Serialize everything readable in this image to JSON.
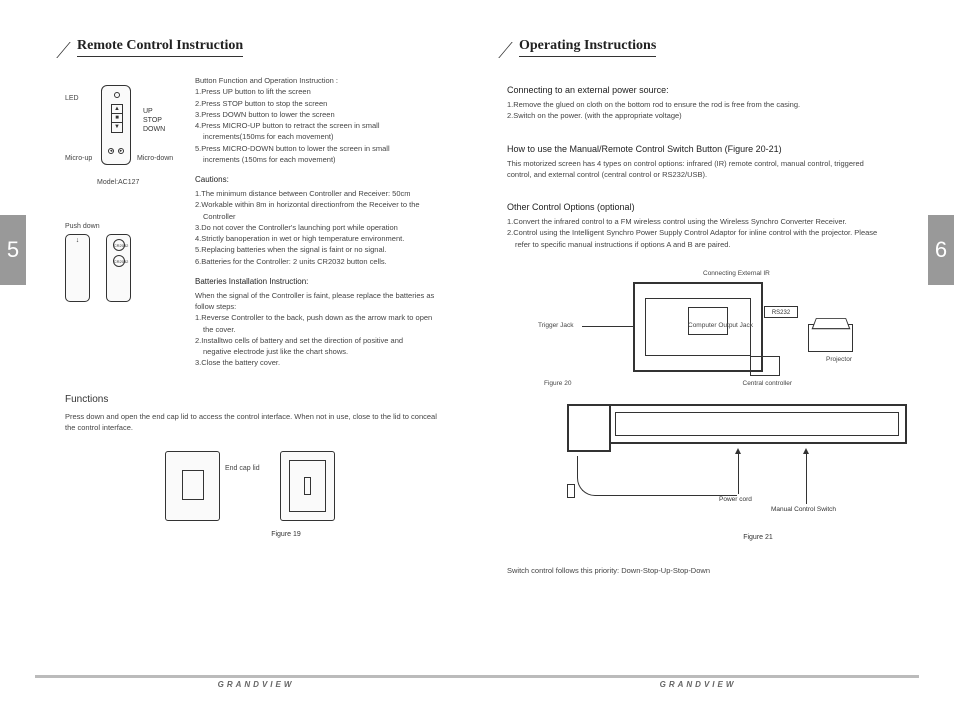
{
  "page_numbers": {
    "left": "5",
    "right": "6"
  },
  "brand": "GRANDVIEW",
  "left": {
    "title": "Remote Control Instruction",
    "diagram_labels": {
      "led": "LED",
      "up": "UP",
      "stop": "STOP",
      "down": "DOWN",
      "micro_up": "Micro-up",
      "micro_down": "Micro-down",
      "model": "Model:AC127",
      "push_down": "Push down",
      "end_cap_lid": "End cap lid"
    },
    "button_func_head": "Button Function and Operation Instruction :",
    "button_func": [
      "1.Press UP button to lift the screen",
      "2.Press STOP button to stop the screen",
      "3.Press DOWN button to lower the screen",
      "4.Press MICRO-UP button to retract the screen in small",
      "   increments(150ms for each movement)",
      "5.Press MICRO-DOWN button to lower the screen in small",
      "   increments (150ms for each movement)"
    ],
    "cautions_head": "Cautions:",
    "cautions": [
      "1.The minimum distance between Controller and Receiver: 50cm",
      "2.Workable within 8m in horizontal directionfrom the Receiver to the",
      "   Controller",
      "3.Do not cover the Controller's launching port while operation",
      "4.Strictly banoperation in wet or high temperature environment.",
      "5.Replacing batteries when the signal is faint or no signal.",
      "6.Batteries for the Controller: 2 units CR2032 button cells."
    ],
    "batt_head": "Batteries Installation Instruction:",
    "batt_intro": "When the signal of the Controller is faint, please replace the batteries as follow steps:",
    "batt_steps": [
      "1.Reverse Controller to the back, push down as the arrow mark to open",
      "   the cover.",
      "2.Installtwo cells of battery and set the direction of positive and",
      "   negative electrode just like the chart shows.",
      "3.Close the battery cover."
    ],
    "functions_head": "Functions",
    "functions_text": "Press down and open the end cap lid to access the control interface. When not in use, close to the lid to conceal the control interface.",
    "fig19": "Figure 19"
  },
  "right": {
    "title": "Operating Instructions",
    "sec1_head": "Connecting to an external power source:",
    "sec1_lines": [
      "1.Remove the glued on cloth on the bottom rod to ensure the rod is free from the casing.",
      "2.Switch on the power. (with the appropriate voltage)"
    ],
    "sec2_head": "How to use the Manual/Remote Control Switch Button (Figure 20-21)",
    "sec2_text": "This motorized screen has 4 types on control options: infrared (IR) remote control, manual control, triggered control, and external control (central control or RS232/USB).",
    "sec3_head": "Other Control Options (optional)",
    "sec3_lines": [
      "1.Convert the infrared control to a FM wireless control using the Wireless Synchro Converter Receiver.",
      "2.Control using the Intelligent Synchro Power Supply Control Adaptor for inline control with the projector. Please",
      "   refer to specific manual instructions if options A and B are paired."
    ],
    "fig20_labels": {
      "trigger": "Trigger Jack",
      "ext_ir": "Connecting External IR",
      "comp_out": "Computer Output Jack",
      "rs232": "RS232",
      "projector": "Projector",
      "central": "Central controller",
      "caption": "Figure 20"
    },
    "fig21_labels": {
      "power_cord": "Power cord",
      "manual_switch": "Manual Control Switch",
      "caption": "Figure 21"
    },
    "priority": "Switch control follows this priority: Down-Stop-Up-Stop-Down"
  }
}
